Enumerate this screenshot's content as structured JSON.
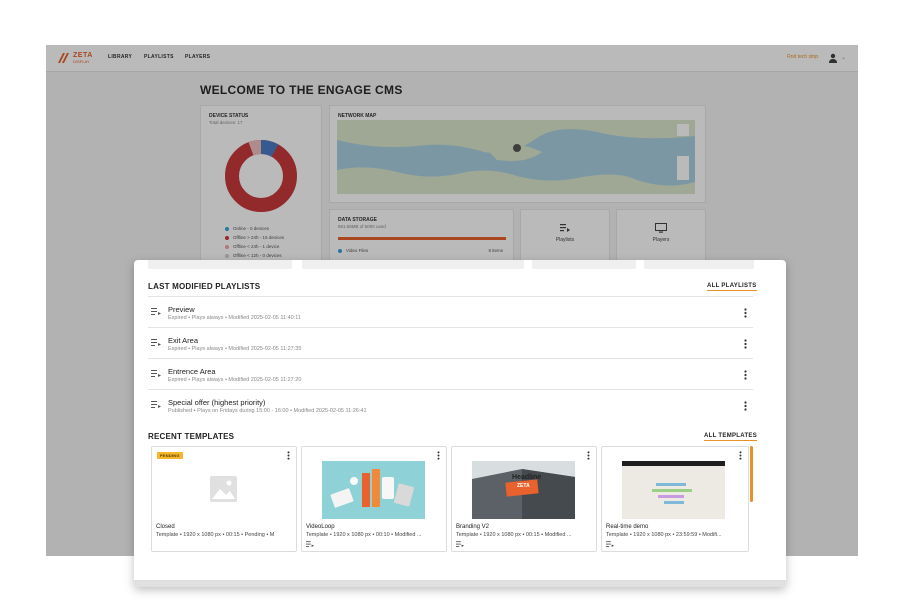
{
  "app": {
    "logo_text": "ZETA",
    "logo_subtext": "DISPLAY",
    "nav": [
      "LIBRARY",
      "PLAYLISTS",
      "PLAYERS"
    ],
    "tour_label": "Rnd tech strip",
    "welcome_title": "WELCOME TO THE ENGAGE CMS",
    "device_status": {
      "title": "DEVICE STATUS",
      "subtitle": "Total devices: 17",
      "legend": [
        {
          "label": "Online - 0 devices",
          "color": "#3aa3d6"
        },
        {
          "label": "Offline > 24h - 15 devices",
          "color": "#c9393b"
        },
        {
          "label": "Offline < 24h - 1 device",
          "color": "#f0a5a5"
        },
        {
          "label": "Offline < 12h - 0 devices",
          "color": "#cfcfcf"
        }
      ]
    },
    "network_map": {
      "title": "NETWORK MAP"
    },
    "data_storage": {
      "title": "DATA STORAGE",
      "subtitle": "861.69MB of 5000 used",
      "item_label": "Video Files",
      "item_count": "8 items"
    },
    "quick_actions": [
      "Playlists",
      "Players"
    ]
  },
  "playlists_section": {
    "title": "LAST MODIFIED PLAYLISTS",
    "link": "ALL PLAYLISTS",
    "items": [
      {
        "name": "Preview",
        "meta": "Expired  •  Plays always  •  Modified 2025-02-05 11:40:11"
      },
      {
        "name": "Exit Area",
        "meta": "Expired  •  Plays always  •  Modified 2025-02-05 11:27:35"
      },
      {
        "name": "Entrence Area",
        "meta": "Expired  •  Plays always  •  Modified 2025-02-05 11:27:20"
      },
      {
        "name": "Special offer (highest priority)",
        "meta": "Published  •  Plays on Fridays during 15:00 - 16:00  •  Modified 2025-02-05 11:26:41"
      }
    ]
  },
  "templates_section": {
    "title": "RECENT TEMPLATES",
    "link": "ALL TEMPLATES",
    "items": [
      {
        "name": "Closed",
        "meta": "Template • 1920 x 1080 px • 00:15 • Pending • M",
        "badge": "PENDING"
      },
      {
        "name": "VideoLoop",
        "meta": "Template • 1920 x 1080 px • 00:10 • Modified ..."
      },
      {
        "name": "Branding V2",
        "meta": "Template • 1920 x 1080 px • 00:15 • Modified ...",
        "thumb_text": "Headline",
        "thumb_logo": "ZETA"
      },
      {
        "name": "Real-time demo",
        "meta": "Template • 1920 x 1080 px • 23:59:59 • Modifi..."
      }
    ]
  },
  "colors": {
    "accent": "#e8912c",
    "brand": "#e8612c",
    "badge": "#f5b72a"
  }
}
